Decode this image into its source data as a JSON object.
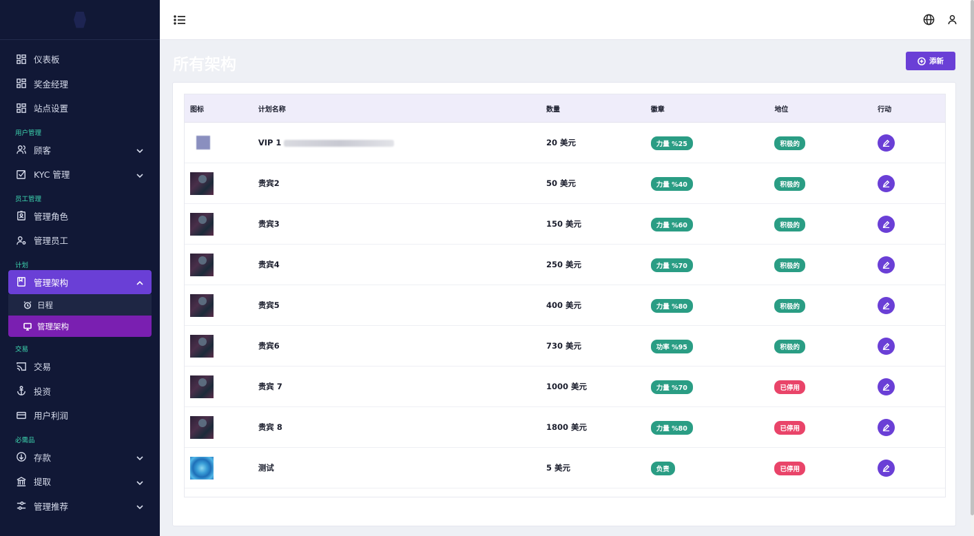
{
  "sidebar": {
    "items": [
      {
        "label": "仪表板",
        "icon": "grid-icon"
      },
      {
        "label": "奖金经理",
        "icon": "grid-icon"
      },
      {
        "label": "站点设置",
        "icon": "grid-icon"
      }
    ],
    "sections": {
      "user_mgmt": "用户管理",
      "staff_mgmt": "员工管理",
      "plan": "计划",
      "trade": "交易",
      "essentials": "必需品"
    },
    "customers": "顾客",
    "kyc": "KYC 管理",
    "roles": "管理角色",
    "staff": "管理员工",
    "manage_schema": "管理架构",
    "schedule": "日程",
    "manage_schema_sub": "管理架构",
    "trade": "交易",
    "invest": "投资",
    "profit": "用户利润",
    "deposit": "存款",
    "withdraw": "提取",
    "referral": "管理推荐"
  },
  "header": {
    "title": "所有架构",
    "add_label": "添新"
  },
  "table": {
    "headers": [
      "图标",
      "计划名称",
      "数量",
      "徽章",
      "地位",
      "行动"
    ],
    "rows": [
      {
        "thumb": "blur",
        "name": "VIP 1",
        "amount": "20 美元",
        "badge": "力量 %25",
        "status": "积极的",
        "status_color": "green"
      },
      {
        "thumb": "robot",
        "name": "贵宾2",
        "amount": "50 美元",
        "badge": "力量 %40",
        "status": "积极的",
        "status_color": "green"
      },
      {
        "thumb": "robot",
        "name": "贵宾3",
        "amount": "150 美元",
        "badge": "力量 %60",
        "status": "积极的",
        "status_color": "green"
      },
      {
        "thumb": "robot",
        "name": "贵宾4",
        "amount": "250 美元",
        "badge": "力量 %70",
        "status": "积极的",
        "status_color": "green"
      },
      {
        "thumb": "robot",
        "name": "贵宾5",
        "amount": "400 美元",
        "badge": "力量 %80",
        "status": "积极的",
        "status_color": "green"
      },
      {
        "thumb": "robot",
        "name": "贵宾6",
        "amount": "730 美元",
        "badge": "功率 %95",
        "status": "积极的",
        "status_color": "green"
      },
      {
        "thumb": "robot",
        "name": "贵宾 7",
        "amount": "1000 美元",
        "badge": "力量 %70",
        "status": "已停用",
        "status_color": "red"
      },
      {
        "thumb": "robot",
        "name": "贵宾 8",
        "amount": "1800 美元",
        "badge": "力量 %80",
        "status": "已停用",
        "status_color": "red"
      },
      {
        "thumb": "swirl",
        "name": "测试",
        "amount": "5 美元",
        "badge": "负责",
        "status": "已停用",
        "status_color": "red"
      }
    ]
  },
  "colors": {
    "sidebar_bg": "#111836",
    "accent": "#6a3fd6",
    "sub_active": "#7a1fb1",
    "green": "#2a9d84",
    "red": "#e94469",
    "section_title": "#3dd6b0"
  }
}
